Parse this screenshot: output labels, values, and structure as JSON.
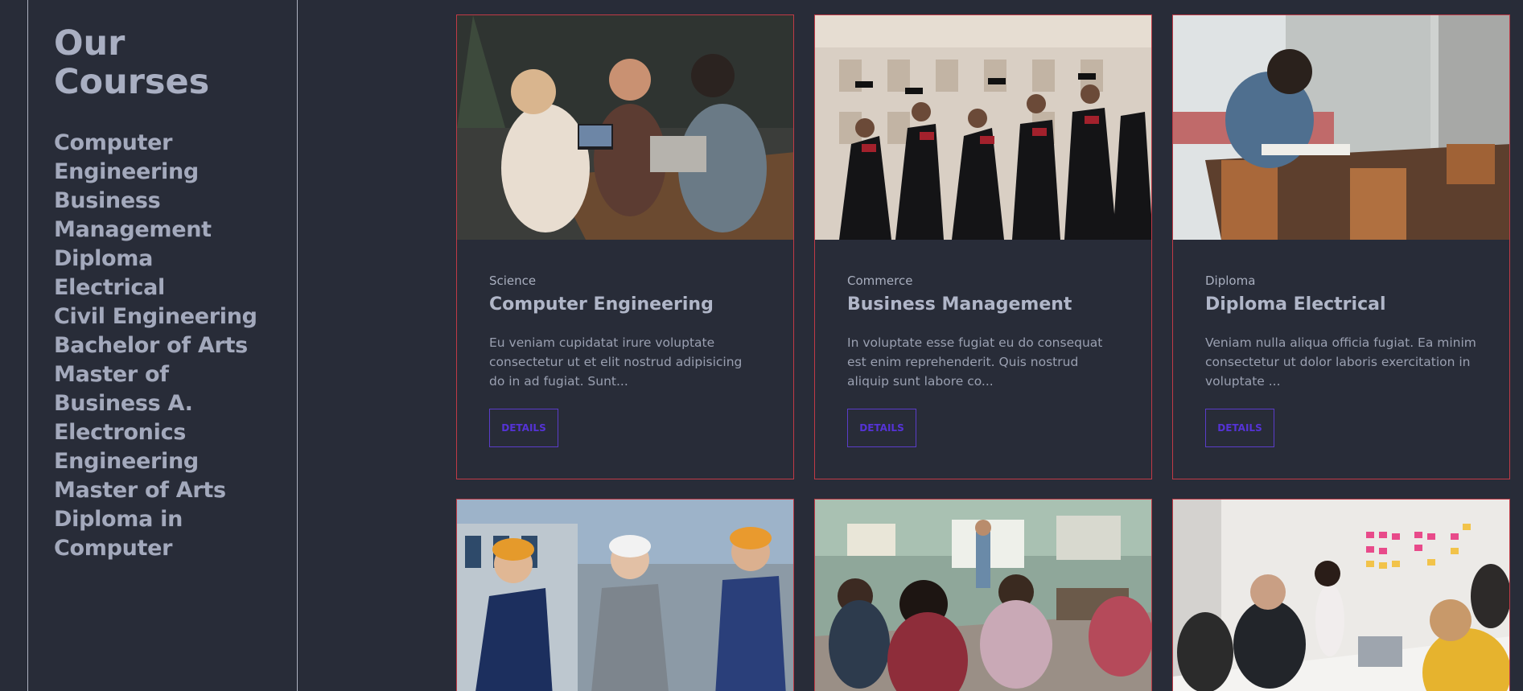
{
  "sidebar": {
    "title": "Our Courses",
    "courses": [
      "Computer Engineering",
      "Business Management",
      "Diploma Electrical",
      "Civil Engineering",
      "Bachelor of Arts",
      "Master of Business A.",
      "Electronics Engineering",
      "Master of Arts",
      "Diploma in Computer"
    ]
  },
  "cards": [
    {
      "category": "Science",
      "title": "Computer Engineering",
      "description": "Eu veniam cupidatat irure voluptate consectetur ut et elit nostrud adipisicing do in ad fugiat. Sunt...",
      "button": "DETAILS",
      "image": "students-with-laptops-photo"
    },
    {
      "category": "Commerce",
      "title": "Business Management",
      "description": "In voluptate esse fugiat eu do consequat est enim reprehenderit. Quis nostrud aliquip sunt labore co...",
      "button": "DETAILS",
      "image": "graduates-throwing-caps-photo"
    },
    {
      "category": "Diploma",
      "title": "Diploma Electrical",
      "description": "Veniam nulla aliqua officia fugiat. Ea minim consectetur ut dolor laboris exercitation in voluptate ...",
      "button": "DETAILS",
      "image": "student-writing-notes-photo"
    },
    {
      "image": "engineers-in-hard-hats-photo"
    },
    {
      "image": "classroom-students-photo"
    },
    {
      "image": "office-presentation-photo"
    }
  ],
  "colors": {
    "background": "#282c38",
    "card_border": "#c03a46",
    "button_accent": "#5533d6"
  }
}
